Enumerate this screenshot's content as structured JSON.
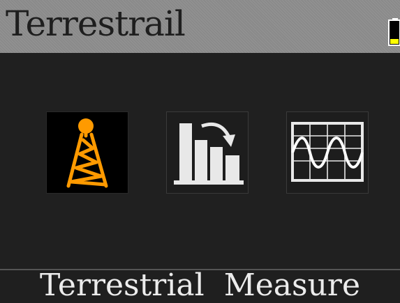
{
  "title_bar": {
    "title": "Terrestrail",
    "battery_icon": "battery-low-icon",
    "battery_color": "#ffff00",
    "battery_level": 0.2
  },
  "menu": {
    "selected_index": 0,
    "accent_color": "#ff9a00",
    "items": [
      {
        "icon": "antenna-tower-icon",
        "selected": true
      },
      {
        "icon": "signal-levels-icon",
        "selected": false
      },
      {
        "icon": "spectrum-waveform-icon",
        "selected": false
      }
    ]
  },
  "footer": {
    "label": "Terrestrial  Measure"
  }
}
